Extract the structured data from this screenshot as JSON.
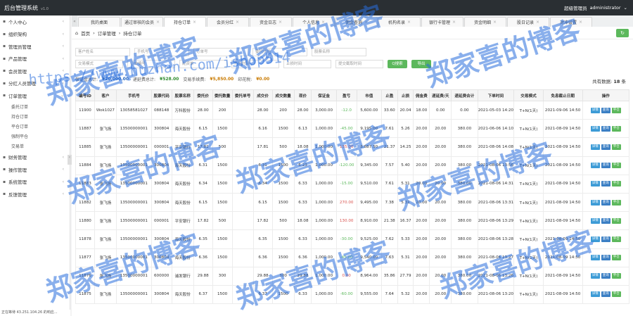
{
  "app": {
    "title": "后台管理系统",
    "version": "v1.0",
    "user_role": "超级管理员",
    "username": "administrator"
  },
  "sidebar": {
    "items": [
      {
        "label": "个人中心",
        "icon": "user-icon"
      },
      {
        "label": "组织架构",
        "icon": "org-icon"
      },
      {
        "label": "管理员管理",
        "icon": "admin-icon"
      },
      {
        "label": "产品管理",
        "icon": "product-icon"
      },
      {
        "label": "会员管理",
        "icon": "member-icon"
      },
      {
        "label": "分红人员管理",
        "icon": "dividend-icon"
      },
      {
        "label": "订单管理",
        "icon": "order-icon"
      }
    ],
    "subitems": [
      "委托订单",
      "持仓订单",
      "平仓订单",
      "强制平仓",
      "交易单"
    ],
    "items2": [
      {
        "label": "财务管理"
      },
      {
        "label": "操作管理"
      },
      {
        "label": "系统管理"
      },
      {
        "label": "反馈管理"
      }
    ],
    "status": "正在等待 43.251.104.26 的响应..."
  },
  "tabs": [
    "我的桌面",
    "通过审核的会员",
    "持仓订单",
    "会员分红",
    "资金日志",
    "个人信息",
    "佣金查询",
    "机构名录",
    "银行卡管理",
    "资金明细",
    "股日记录",
    "对冲设置"
  ],
  "breadcrumb": [
    "首页",
    "订单管理",
    "持仓订单"
  ],
  "filters": {
    "row1": [
      "客户姓名",
      "手机号",
      "订单号",
      "委托代码",
      "股票名称"
    ],
    "row2": [
      "交易模式",
      "订单编号",
      "配资单",
      "开始时间",
      "止损时间",
      "提交截取时间"
    ],
    "search": "Q搜索",
    "export": "导出"
  },
  "totals": {
    "label1": "保证金总计:",
    "val1": "¥20,000.00",
    "label2": "递延费总计:",
    "val2": "¥528.00",
    "label3": "交易手续费:",
    "val3": "¥5,850.00",
    "label4": "印花税:",
    "val4": "¥0.00"
  },
  "count": {
    "label": "共有数据:",
    "value": "18",
    "unit": "条"
  },
  "table": {
    "headers": [
      "编号ID",
      "客户",
      "手机号",
      "股票代码",
      "股票名称",
      "委托价",
      "委托数量",
      "委托单号",
      "成交价",
      "成交数量",
      "现价",
      "保证金",
      "盈亏",
      "市值",
      "止盈",
      "止损",
      "佣金费",
      "递延费/天",
      "递延费合计",
      "下单时间",
      "交易模式",
      "免息截止日期",
      "操作"
    ],
    "rows": [
      [
        "11900",
        "Wok1027",
        "13058581027",
        "088148",
        "万科股份",
        "28.00",
        "200",
        "",
        "28.00",
        "200",
        "28.00",
        "3,000.00",
        "-12.0",
        "5,600.00",
        "33.60",
        "20.04",
        "18.00",
        "0.00",
        "0.00",
        "2021-05-03 14:20",
        "T+N(1天)",
        "2021-09-06 14:50"
      ],
      [
        "11887",
        "张飞扬",
        "13500000001",
        "300804",
        "海天股份",
        "6.15",
        "1500",
        "",
        "6.16",
        "1500",
        "6.13",
        "1,000.00",
        "-45.00",
        "9,195.00",
        "7.61",
        "5.26",
        "20.00",
        "20.00",
        "380.00",
        "2021-06-06 14:10",
        "T+N(1天)",
        "2021-08-09 14:50"
      ],
      [
        "11885",
        "张飞扬",
        "13500000001",
        "000001",
        "平安银行",
        "17.81",
        "500",
        "",
        "17.81",
        "500",
        "18.08",
        "1,000.00",
        "135.00",
        "8,887.50",
        "21.37",
        "14.25",
        "20.00",
        "20.00",
        "380.00",
        "2021-08-06 14:08",
        "T+N(1天)",
        "2021-08-09 14:50"
      ],
      [
        "11884",
        "张飞扬",
        "13500000001",
        "300804",
        "海天股份",
        "6.31",
        "1500",
        "",
        "6.31",
        "1500",
        "6.23",
        "1,000.00",
        "-120.00",
        "9,345.00",
        "7.57",
        "5.40",
        "20.00",
        "20.00",
        "380.00",
        "2021-08-06 13:56",
        "T+N(1天)",
        "2021-08-09 14:50"
      ],
      [
        "11883",
        "张飞扬",
        "13500000001",
        "300804",
        "海天股份",
        "6.34",
        "1500",
        "",
        "6.34",
        "1500",
        "6.33",
        "1,000.00",
        "-15.00",
        "9,510.00",
        "7.61",
        "5.31",
        "20.00",
        "20.00",
        "380.00",
        "2021-08-06 14:31",
        "T+N(1天)",
        "2021-08-09 14:50"
      ],
      [
        "11882",
        "张飞扬",
        "13500000001",
        "300804",
        "海天股份",
        "6.15",
        "1500",
        "",
        "6.15",
        "1500",
        "6.33",
        "1,000.00",
        "270.00",
        "9,495.00",
        "7.38",
        "5.31",
        "20.00",
        "20.00",
        "380.00",
        "2021-08-06 13:31",
        "T+N(1天)",
        "2021-08-09 14:50"
      ],
      [
        "11880",
        "张飞扬",
        "13500000001",
        "000001",
        "平安银行",
        "17.82",
        "500",
        "",
        "17.82",
        "500",
        "18.08",
        "1,000.00",
        "130.00",
        "8,910.00",
        "21.38",
        "16.37",
        "20.00",
        "20.00",
        "380.00",
        "2021-08-06 13:29",
        "T+N(1天)",
        "2021-08-09 14:50"
      ],
      [
        "11878",
        "张飞扬",
        "13500000001",
        "300804",
        "海天股份",
        "6.35",
        "1500",
        "",
        "6.35",
        "1500",
        "6.33",
        "1,000.00",
        "-30.00",
        "9,525.00",
        "7.62",
        "5.33",
        "20.00",
        "20.00",
        "380.00",
        "2021-08-06 13:28",
        "T+N(1天)",
        "2021-08-09 14:50"
      ],
      [
        "11877",
        "张飞扬",
        "13500000001",
        "300804",
        "海天股份",
        "6.36",
        "1500",
        "",
        "6.36",
        "1500",
        "6.36",
        "1,000.00",
        "-45.00",
        "9,540.00",
        "7.63",
        "5.31",
        "20.00",
        "20.00",
        "380.00",
        "2021-08-06 13:27",
        "T+N(1天)",
        "2021-08-09 14:50"
      ],
      [
        "11876",
        "张飞扬",
        "13500000001",
        "600000",
        "浦发银行",
        "29.88",
        "300",
        "",
        "29.88",
        "300",
        "29.88",
        "1,000.00",
        "0.00",
        "8,964.00",
        "35.86",
        "27.79",
        "20.00",
        "20.00",
        "380.00",
        "2021-08-06 13:26",
        "T+N(1天)",
        "2021-08-09 14:50"
      ],
      [
        "11875",
        "张飞扬",
        "13500000001",
        "300804",
        "海天股份",
        "6.37",
        "1500",
        "",
        "6.37",
        "1500",
        "6.33",
        "1,000.00",
        "-60.00",
        "9,555.00",
        "7.64",
        "5.32",
        "20.00",
        "20.00",
        "380.00",
        "2021-08-06 13:20",
        "T+N(1天)",
        "2021-08-09 14:50"
      ]
    ],
    "ops": [
      "详情",
      "查询",
      "平仓"
    ]
  },
  "watermarks": {
    "text": "郑家喜的博客",
    "url": "https://www.huzhan.com/ishop514"
  }
}
